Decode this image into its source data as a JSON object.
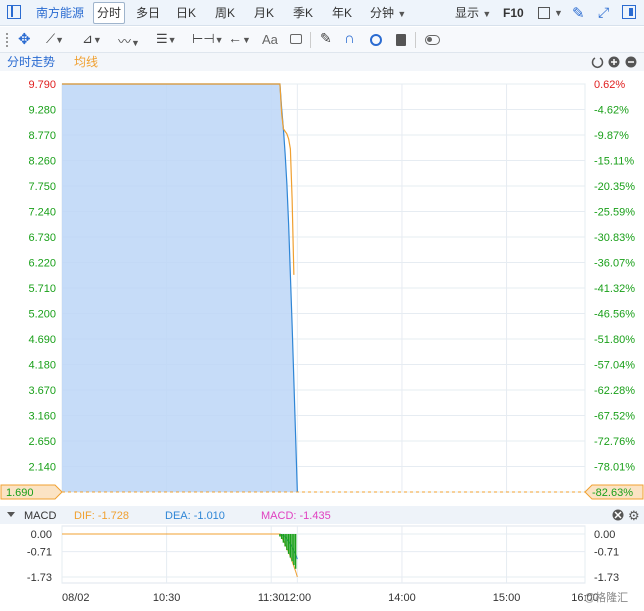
{
  "header": {
    "stock_name": "南方能源",
    "tabs": [
      {
        "label": "分时",
        "active": true
      },
      {
        "label": "多日"
      },
      {
        "label": "日K"
      },
      {
        "label": "周K"
      },
      {
        "label": "月K"
      },
      {
        "label": "季K"
      },
      {
        "label": "年K"
      },
      {
        "label": "分钟"
      }
    ],
    "display_label": "显示",
    "f10_label": "F10"
  },
  "toolbar": {
    "icons": [
      "crosshair-icon",
      "line-tool-icon",
      "channel-tool-icon",
      "wave-tool-icon",
      "fib-tool-icon",
      "range-tool-icon",
      "arrow-tool-icon",
      "text-tool-icon",
      "comment-icon",
      "pen-icon",
      "magnet-icon",
      "eye-icon",
      "trash-icon",
      "toggle-icon"
    ],
    "text_tool_label": "Aa"
  },
  "legend": {
    "price_label": "分时走势",
    "avg_label": "均线"
  },
  "macd": {
    "title": "MACD",
    "dif_text": "DIF: -1.728",
    "dea_text": "DEA: -1.010",
    "macd_text": "MACD: -1.435"
  },
  "watermark": "@格隆汇",
  "colors": {
    "price_line": "#2f86d6",
    "price_fill": "#bcd6f7",
    "avg_line": "#f0a030",
    "up": "#e02020",
    "down": "#1aa01a",
    "dif": "#f0a030",
    "dea": "#2f86d6",
    "macd_text": "#e040c0",
    "last_price_bg": "#fbe3c4"
  },
  "chart_data": {
    "type": "line",
    "prev_close": 9.79,
    "last_price_label": "1.690",
    "last_pct_label": "-82.63%",
    "y_price_ticks": [
      "9.790",
      "9.280",
      "8.770",
      "8.260",
      "7.750",
      "7.240",
      "6.730",
      "6.220",
      "5.710",
      "5.200",
      "4.690",
      "4.180",
      "3.670",
      "3.160",
      "2.650",
      "2.140",
      "1.690"
    ],
    "y_pct_ticks": [
      "0.62%",
      "-4.62%",
      "-9.87%",
      "-15.11%",
      "-20.35%",
      "-25.59%",
      "-30.83%",
      "-36.07%",
      "-41.32%",
      "-46.56%",
      "-51.80%",
      "-57.04%",
      "-62.28%",
      "-67.52%",
      "-72.76%",
      "-78.01%",
      "-82.63%"
    ],
    "ylim": [
      1.69,
      9.79
    ],
    "x_ticks": [
      {
        "label": "08/02",
        "min": 0
      },
      {
        "label": "10:30",
        "min": 60
      },
      {
        "label": "11:30",
        "min": 120
      },
      {
        "label": "12:00",
        "min": 135
      },
      {
        "label": "14:00",
        "min": 195
      },
      {
        "label": "15:00",
        "min": 255
      },
      {
        "label": "16:00",
        "min": 300
      }
    ],
    "x_range": [
      0,
      300
    ],
    "series": [
      {
        "x": [
          0,
          30,
          60,
          90,
          120,
          125,
          126,
          127,
          128,
          129,
          130,
          131,
          132,
          133,
          134,
          135
        ],
        "y": [
          9.79,
          9.79,
          9.79,
          9.79,
          9.79,
          9.79,
          9.3,
          8.9,
          8.4,
          7.8,
          7.0,
          6.0,
          5.0,
          3.9,
          2.8,
          1.69
        ]
      },
      {
        "x": [
          0,
          125,
          126,
          127,
          128,
          129,
          130,
          131,
          132,
          133
        ],
        "y": [
          9.79,
          9.79,
          9.2,
          8.9,
          8.85,
          8.8,
          8.7,
          8.5,
          7.5,
          6.0
        ]
      }
    ],
    "macd_ticks": [
      "0.00",
      "-0.71",
      "-1.73"
    ],
    "macd_ylim": [
      -1.73,
      0.0
    ],
    "macd_hist": {
      "x": [
        125,
        126,
        127,
        128,
        129,
        130,
        131,
        132,
        133,
        134
      ],
      "values": [
        -0.1,
        -0.2,
        -0.35,
        -0.5,
        -0.65,
        -0.8,
        -0.95,
        -1.1,
        -1.25,
        -1.4
      ]
    },
    "macd_dif": {
      "x": [
        0,
        125,
        128,
        131,
        134,
        135
      ],
      "values": [
        0,
        0,
        -0.4,
        -0.9,
        -1.5,
        -1.728
      ]
    },
    "macd_dea": {
      "x": [
        0,
        125,
        128,
        131,
        134,
        135
      ],
      "values": [
        0,
        0,
        -0.1,
        -0.4,
        -0.8,
        -1.01
      ]
    }
  }
}
